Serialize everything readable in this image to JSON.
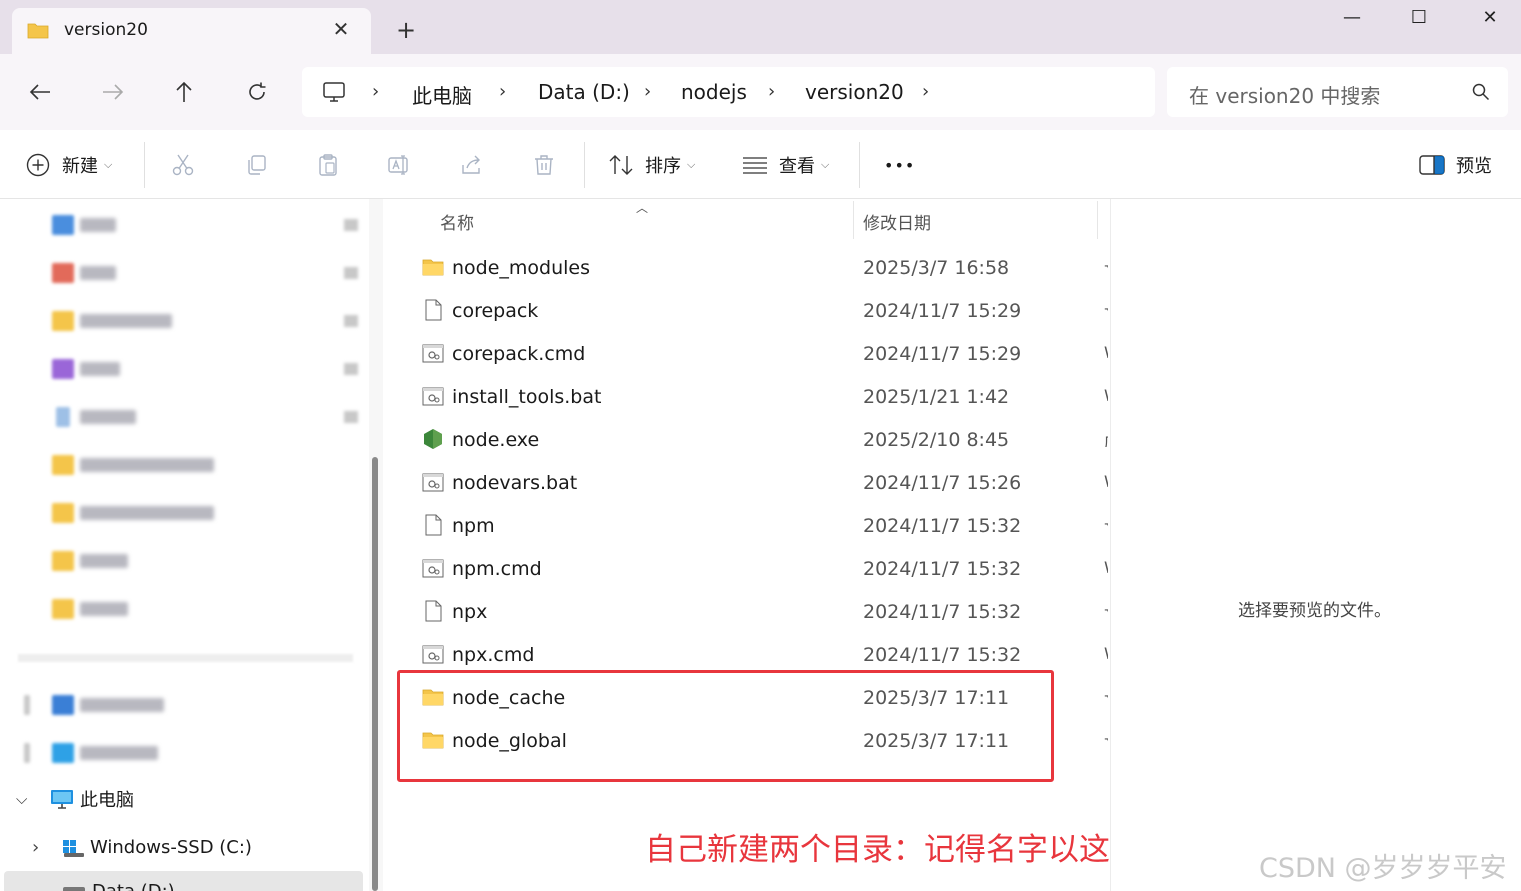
{
  "window": {
    "tab_title": "version20",
    "tab_close_glyph": "✕",
    "new_tab_glyph": "+",
    "minimize_glyph": "—",
    "maximize_glyph": "☐",
    "close_glyph": "✕"
  },
  "address": {
    "breadcrumbs": [
      "此电脑",
      "Data (D:)",
      "nodejs",
      "version20"
    ],
    "separator": "›",
    "search_placeholder": "在 version20 中搜索"
  },
  "toolbar": {
    "new_label": "新建",
    "sort_label": "排序",
    "view_label": "查看",
    "more_label": "•••",
    "preview_label": "预览"
  },
  "navigation": {
    "this_pc_label": "此电脑",
    "drive_c_label": "Windows-SSD (C:)",
    "drive_d_label": "Data (D:)"
  },
  "columns": {
    "name": "名称",
    "modified": "修改日期"
  },
  "files": [
    {
      "name": "node_modules",
      "date": "2025/3/7 16:58",
      "icon": "folder-icon",
      "type_stub": "文"
    },
    {
      "name": "corepack",
      "date": "2024/11/7 15:29",
      "icon": "file-icon",
      "type_stub": "文"
    },
    {
      "name": "corepack.cmd",
      "date": "2024/11/7 15:29",
      "icon": "script-icon",
      "type_stub": "W"
    },
    {
      "name": "install_tools.bat",
      "date": "2025/1/21 1:42",
      "icon": "script-icon",
      "type_stub": "W"
    },
    {
      "name": "node.exe",
      "date": "2025/2/10 8:45",
      "icon": "nodejs-icon",
      "type_stub": "应"
    },
    {
      "name": "nodevars.bat",
      "date": "2024/11/7 15:26",
      "icon": "script-icon",
      "type_stub": "W"
    },
    {
      "name": "npm",
      "date": "2024/11/7 15:32",
      "icon": "file-icon",
      "type_stub": "文"
    },
    {
      "name": "npm.cmd",
      "date": "2024/11/7 15:32",
      "icon": "script-icon",
      "type_stub": "W"
    },
    {
      "name": "npx",
      "date": "2024/11/7 15:32",
      "icon": "file-icon",
      "type_stub": "文"
    },
    {
      "name": "npx.cmd",
      "date": "2024/11/7 15:32",
      "icon": "script-icon",
      "type_stub": "W"
    },
    {
      "name": "node_cache",
      "date": "2025/3/7 17:11",
      "icon": "folder-icon",
      "type_stub": "文"
    },
    {
      "name": "node_global",
      "date": "2025/3/7 17:11",
      "icon": "folder-icon",
      "type_stub": "文"
    }
  ],
  "annotation_text": "自己新建两个目录：记得名字以这个起名！",
  "preview_text": "选择要预览的文件。",
  "watermark": "CSDN @岁岁岁平安",
  "colors": {
    "highlight": "#e8363d",
    "folder": "#f4c54a",
    "titlebar": "#e7e0ea"
  }
}
